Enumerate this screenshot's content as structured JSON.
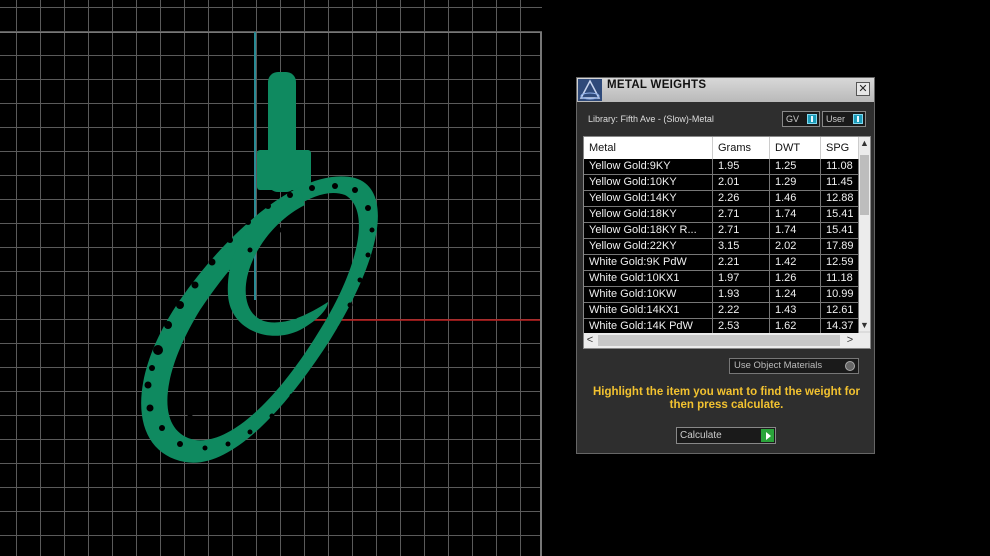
{
  "viewport": {
    "axis_colors": {
      "y_axis": "#2a8a94",
      "x_axis": "#c02020"
    },
    "model_color": "#0f8a60"
  },
  "panel": {
    "title": "METAL WEIGHTS",
    "logo_icon": "logo-icon",
    "close_label": "✕",
    "library_label": "Library: Fifth Ave - (Slow)-Metal",
    "gv_label": "GV",
    "user_label": "User",
    "table": {
      "headers": [
        "Metal",
        "Grams",
        "DWT",
        "SPG"
      ],
      "rows": [
        [
          "Yellow Gold:9KY",
          "1.95",
          "1.25",
          "11.08"
        ],
        [
          "Yellow Gold:10KY",
          "2.01",
          "1.29",
          "11.45"
        ],
        [
          "Yellow Gold:14KY",
          "2.26",
          "1.46",
          "12.88"
        ],
        [
          "Yellow Gold:18KY",
          "2.71",
          "1.74",
          "15.41"
        ],
        [
          "Yellow Gold:18KY R...",
          "2.71",
          "1.74",
          "15.41"
        ],
        [
          "Yellow Gold:22KY",
          "3.15",
          "2.02",
          "17.89"
        ],
        [
          "White Gold:9K PdW",
          "2.21",
          "1.42",
          "12.59"
        ],
        [
          "White Gold:10KX1",
          "1.97",
          "1.26",
          "11.18"
        ],
        [
          "White Gold:10KW",
          "1.93",
          "1.24",
          "10.99"
        ],
        [
          "White Gold:14KX1",
          "2.22",
          "1.43",
          "12.61"
        ],
        [
          "White Gold:14K PdW",
          "2.53",
          "1.62",
          "14.37"
        ]
      ]
    },
    "use_materials_label": "Use Object Materials",
    "instructions": "Highlight the item you want to find the weight for then press calculate.",
    "calculate_label": "Calculate"
  }
}
